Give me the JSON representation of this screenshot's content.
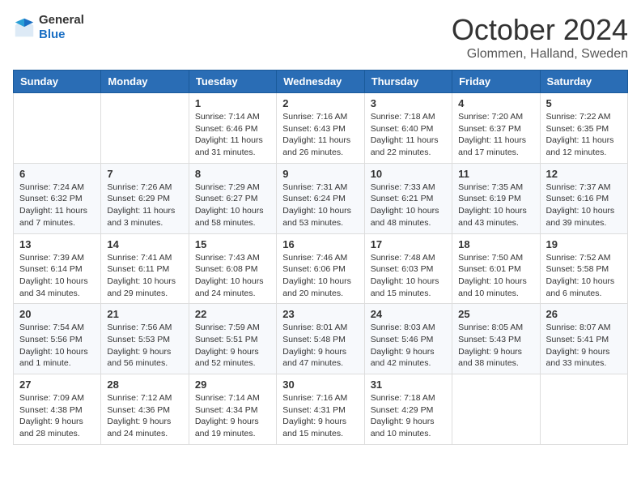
{
  "header": {
    "logo": {
      "general": "General",
      "blue": "Blue"
    },
    "title": "October 2024",
    "location": "Glommen, Halland, Sweden"
  },
  "weekdays": [
    "Sunday",
    "Monday",
    "Tuesday",
    "Wednesday",
    "Thursday",
    "Friday",
    "Saturday"
  ],
  "weeks": [
    [
      {
        "day": "",
        "info": ""
      },
      {
        "day": "",
        "info": ""
      },
      {
        "day": "1",
        "info": "Sunrise: 7:14 AM\nSunset: 6:46 PM\nDaylight: 11 hours and 31 minutes."
      },
      {
        "day": "2",
        "info": "Sunrise: 7:16 AM\nSunset: 6:43 PM\nDaylight: 11 hours and 26 minutes."
      },
      {
        "day": "3",
        "info": "Sunrise: 7:18 AM\nSunset: 6:40 PM\nDaylight: 11 hours and 22 minutes."
      },
      {
        "day": "4",
        "info": "Sunrise: 7:20 AM\nSunset: 6:37 PM\nDaylight: 11 hours and 17 minutes."
      },
      {
        "day": "5",
        "info": "Sunrise: 7:22 AM\nSunset: 6:35 PM\nDaylight: 11 hours and 12 minutes."
      }
    ],
    [
      {
        "day": "6",
        "info": "Sunrise: 7:24 AM\nSunset: 6:32 PM\nDaylight: 11 hours and 7 minutes."
      },
      {
        "day": "7",
        "info": "Sunrise: 7:26 AM\nSunset: 6:29 PM\nDaylight: 11 hours and 3 minutes."
      },
      {
        "day": "8",
        "info": "Sunrise: 7:29 AM\nSunset: 6:27 PM\nDaylight: 10 hours and 58 minutes."
      },
      {
        "day": "9",
        "info": "Sunrise: 7:31 AM\nSunset: 6:24 PM\nDaylight: 10 hours and 53 minutes."
      },
      {
        "day": "10",
        "info": "Sunrise: 7:33 AM\nSunset: 6:21 PM\nDaylight: 10 hours and 48 minutes."
      },
      {
        "day": "11",
        "info": "Sunrise: 7:35 AM\nSunset: 6:19 PM\nDaylight: 10 hours and 43 minutes."
      },
      {
        "day": "12",
        "info": "Sunrise: 7:37 AM\nSunset: 6:16 PM\nDaylight: 10 hours and 39 minutes."
      }
    ],
    [
      {
        "day": "13",
        "info": "Sunrise: 7:39 AM\nSunset: 6:14 PM\nDaylight: 10 hours and 34 minutes."
      },
      {
        "day": "14",
        "info": "Sunrise: 7:41 AM\nSunset: 6:11 PM\nDaylight: 10 hours and 29 minutes."
      },
      {
        "day": "15",
        "info": "Sunrise: 7:43 AM\nSunset: 6:08 PM\nDaylight: 10 hours and 24 minutes."
      },
      {
        "day": "16",
        "info": "Sunrise: 7:46 AM\nSunset: 6:06 PM\nDaylight: 10 hours and 20 minutes."
      },
      {
        "day": "17",
        "info": "Sunrise: 7:48 AM\nSunset: 6:03 PM\nDaylight: 10 hours and 15 minutes."
      },
      {
        "day": "18",
        "info": "Sunrise: 7:50 AM\nSunset: 6:01 PM\nDaylight: 10 hours and 10 minutes."
      },
      {
        "day": "19",
        "info": "Sunrise: 7:52 AM\nSunset: 5:58 PM\nDaylight: 10 hours and 6 minutes."
      }
    ],
    [
      {
        "day": "20",
        "info": "Sunrise: 7:54 AM\nSunset: 5:56 PM\nDaylight: 10 hours and 1 minute."
      },
      {
        "day": "21",
        "info": "Sunrise: 7:56 AM\nSunset: 5:53 PM\nDaylight: 9 hours and 56 minutes."
      },
      {
        "day": "22",
        "info": "Sunrise: 7:59 AM\nSunset: 5:51 PM\nDaylight: 9 hours and 52 minutes."
      },
      {
        "day": "23",
        "info": "Sunrise: 8:01 AM\nSunset: 5:48 PM\nDaylight: 9 hours and 47 minutes."
      },
      {
        "day": "24",
        "info": "Sunrise: 8:03 AM\nSunset: 5:46 PM\nDaylight: 9 hours and 42 minutes."
      },
      {
        "day": "25",
        "info": "Sunrise: 8:05 AM\nSunset: 5:43 PM\nDaylight: 9 hours and 38 minutes."
      },
      {
        "day": "26",
        "info": "Sunrise: 8:07 AM\nSunset: 5:41 PM\nDaylight: 9 hours and 33 minutes."
      }
    ],
    [
      {
        "day": "27",
        "info": "Sunrise: 7:09 AM\nSunset: 4:38 PM\nDaylight: 9 hours and 28 minutes."
      },
      {
        "day": "28",
        "info": "Sunrise: 7:12 AM\nSunset: 4:36 PM\nDaylight: 9 hours and 24 minutes."
      },
      {
        "day": "29",
        "info": "Sunrise: 7:14 AM\nSunset: 4:34 PM\nDaylight: 9 hours and 19 minutes."
      },
      {
        "day": "30",
        "info": "Sunrise: 7:16 AM\nSunset: 4:31 PM\nDaylight: 9 hours and 15 minutes."
      },
      {
        "day": "31",
        "info": "Sunrise: 7:18 AM\nSunset: 4:29 PM\nDaylight: 9 hours and 10 minutes."
      },
      {
        "day": "",
        "info": ""
      },
      {
        "day": "",
        "info": ""
      }
    ]
  ]
}
